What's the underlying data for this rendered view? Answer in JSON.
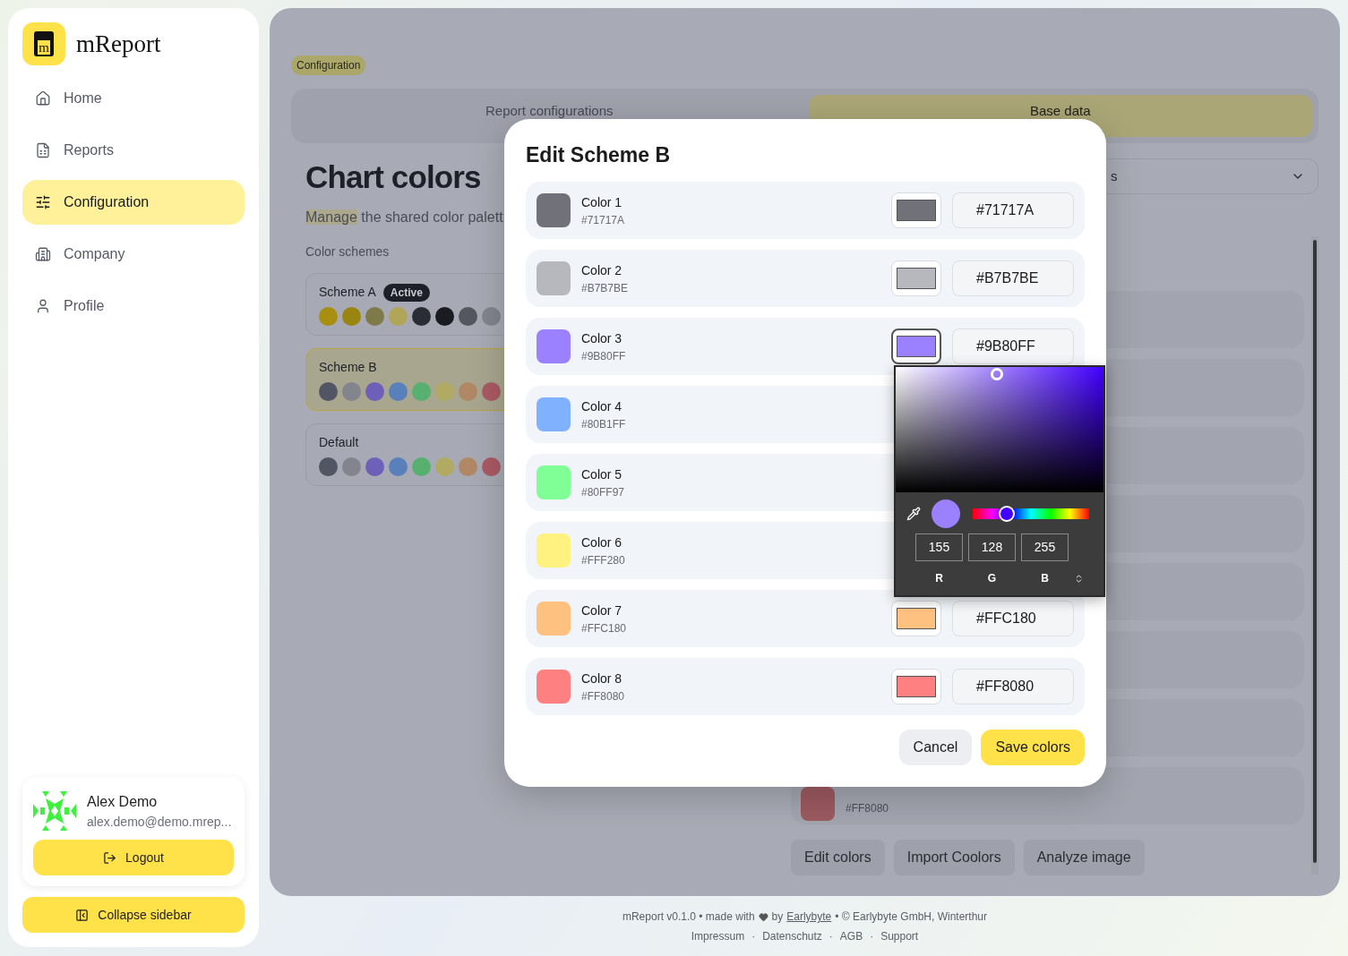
{
  "sidebar": {
    "logo_letter": "m",
    "app_name": "mReport",
    "items": [
      {
        "label": "Home",
        "selected": false
      },
      {
        "label": "Reports",
        "selected": false
      },
      {
        "label": "Configuration",
        "selected": true
      },
      {
        "label": "Company",
        "selected": false
      },
      {
        "label": "Profile",
        "selected": false
      }
    ],
    "user": {
      "name": "Alex Demo",
      "email": "alex.demo@demo.mrep..."
    },
    "logout": "Logout",
    "collapse": "Collapse sidebar"
  },
  "breadcrumb": "Configuration",
  "tabs": [
    {
      "label": "Report configurations",
      "selected": false
    },
    {
      "label": "Base data",
      "selected": true
    }
  ],
  "page": {
    "title": "Chart colors",
    "subtitle_highlight": "Manage",
    "subtitle_rest": "the shared color palett",
    "schemes_label": "Color schemes"
  },
  "schemes": [
    {
      "name": "Scheme A",
      "badge": "Active",
      "selected": false,
      "dots": [
        {
          "color": "#a88f10"
        },
        {
          "color": "#9a8510"
        },
        {
          "color": "#7f7a4a"
        },
        {
          "color": "#b1a55a"
        },
        {
          "color": "#2a2d33"
        },
        {
          "color": "#1b1c22"
        },
        {
          "color": "#545660"
        },
        {
          "color": "#82848e"
        }
      ]
    },
    {
      "name": "Scheme B",
      "selected": true,
      "dots": [
        {
          "color": "#525564"
        },
        {
          "color": "#82848e"
        },
        {
          "color": "#6e5fb8"
        },
        {
          "color": "#5a80bb"
        },
        {
          "color": "#58b070"
        },
        {
          "color": "#b0aa62"
        },
        {
          "color": "#b08866"
        },
        {
          "color": "#aa5a64"
        }
      ]
    },
    {
      "name": "Default",
      "selected": false,
      "dots": [
        {
          "color": "#525564"
        },
        {
          "color": "#82848e"
        },
        {
          "color": "#6e5fb8"
        },
        {
          "color": "#5a80bb"
        },
        {
          "color": "#58b070"
        },
        {
          "color": "#b0aa62"
        },
        {
          "color": "#b08866"
        },
        {
          "color": "#aa5a64"
        }
      ]
    }
  ],
  "scheme_select": {
    "value": "s"
  },
  "background_row": {
    "code": "#FF8080",
    "color": "#9b5a60"
  },
  "actions": [
    "Edit colors",
    "Import Coolors",
    "Analyze image"
  ],
  "dialog": {
    "title": "Edit Scheme B",
    "colors": [
      {
        "name": "Color 1",
        "code": "#71717A",
        "color": "#71717a",
        "value": "#71717A",
        "open": false
      },
      {
        "name": "Color 2",
        "code": "#B7B7BE",
        "color": "#b7b7be",
        "value": "#B7B7BE",
        "open": false
      },
      {
        "name": "Color 3",
        "code": "#9B80FF",
        "color": "#9b80ff",
        "value": "#9B80FF",
        "open": true
      },
      {
        "name": "Color 4",
        "code": "#80B1FF",
        "color": "#80b1ff",
        "open": false
      },
      {
        "name": "Color 5",
        "code": "#80FF97",
        "color": "#80ff97",
        "open": false
      },
      {
        "name": "Color 6",
        "code": "#FFF280",
        "color": "#fff280",
        "open": false
      },
      {
        "name": "Color 7",
        "code": "#FFC180",
        "color": "#ffc180",
        "value": "#FFC180",
        "open": false
      },
      {
        "name": "Color 8",
        "code": "#FF8080",
        "color": "#ff8080",
        "value": "#FF8080",
        "open": false
      }
    ],
    "picker": {
      "hue": {
        "level": 0.29
      },
      "channels": [
        {
          "value": "155",
          "label": "R"
        },
        {
          "value": "128",
          "label": "G"
        },
        {
          "value": "255",
          "label": "B"
        }
      ]
    },
    "buttons": [
      {
        "label": "Cancel",
        "kind": "secondary"
      },
      {
        "label": "Save colors",
        "kind": "primary"
      }
    ]
  },
  "footer": {
    "before": "mReport v0.1.0 • made with",
    "by": "by",
    "link": "Earlybyte",
    "after": "• © Earlybyte GmbH, Winterthur",
    "separator": "·",
    "links": [
      "Impressum",
      "Datenschutz",
      "AGB",
      "Support"
    ]
  }
}
